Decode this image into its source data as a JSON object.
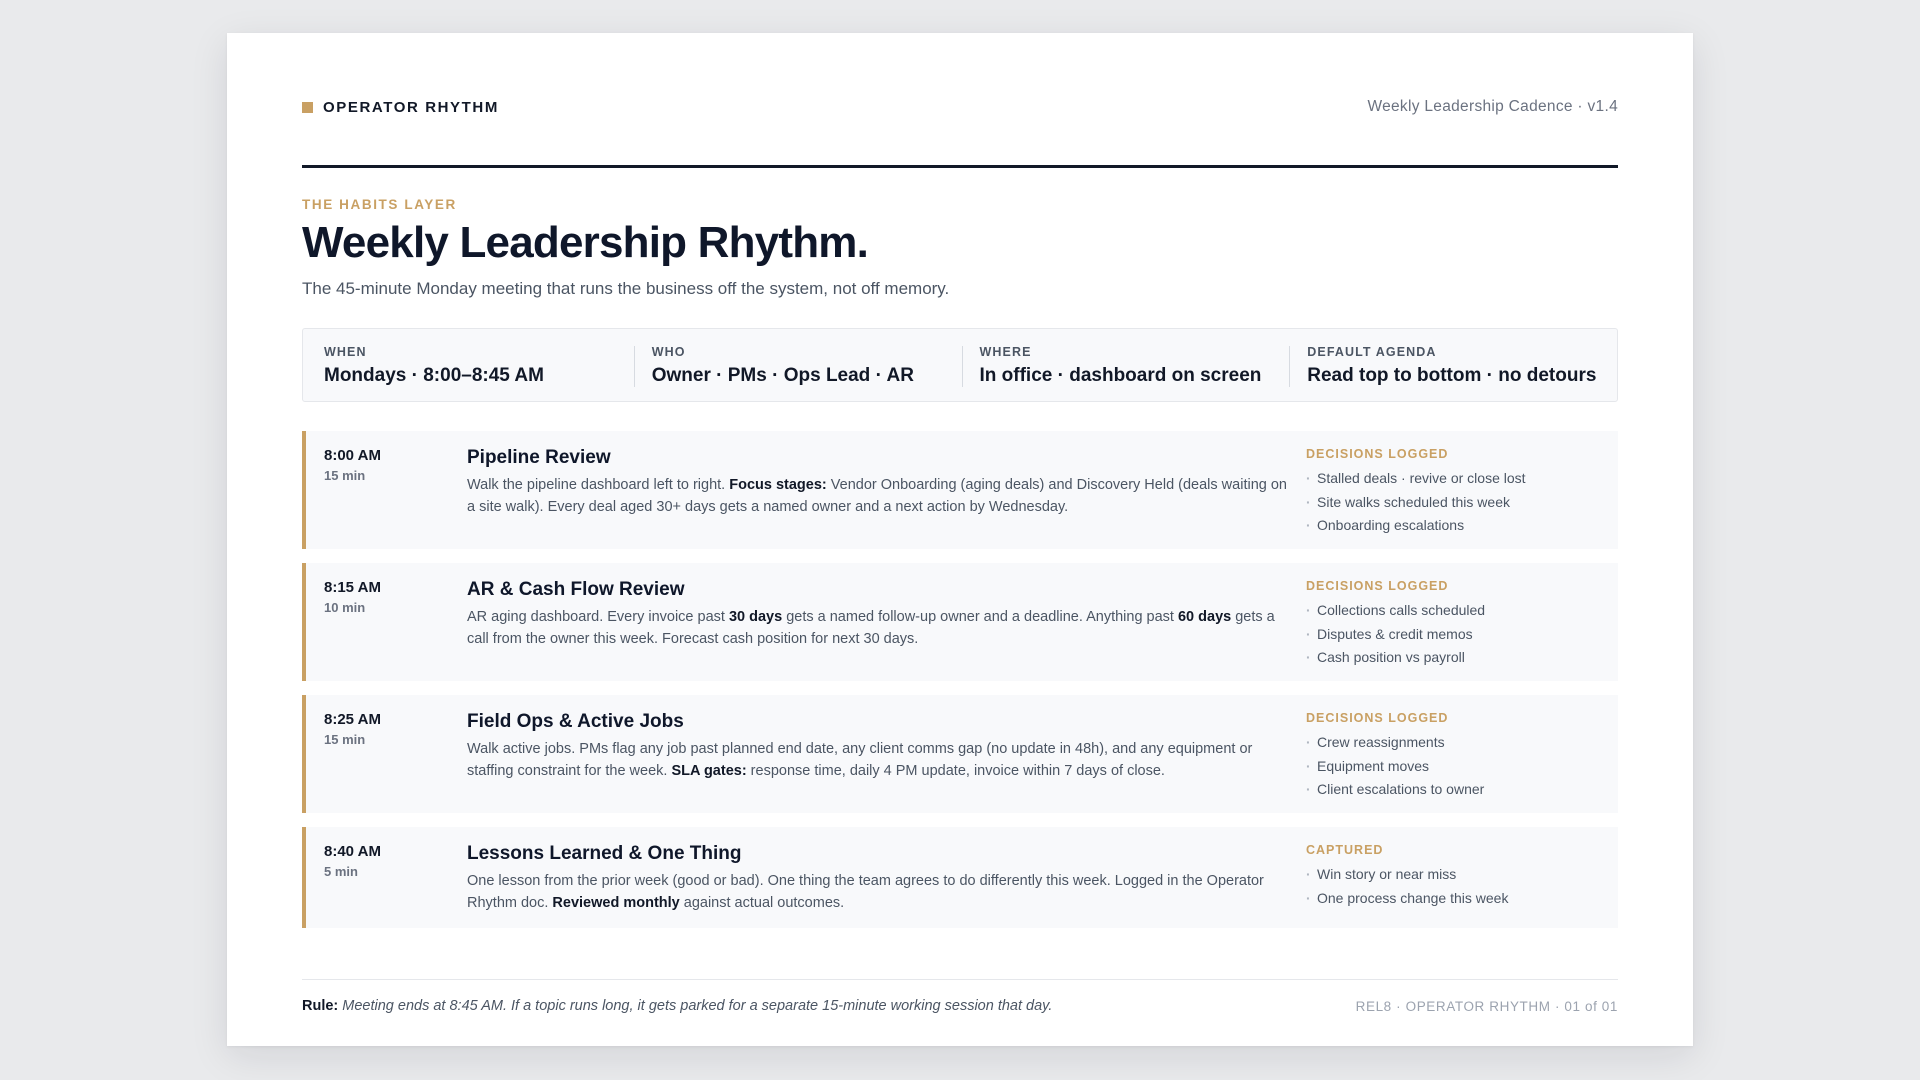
{
  "header": {
    "brand": "OPERATOR RHYTHM",
    "doc_version": "Weekly Leadership Cadence · v1.4"
  },
  "eyebrow": "THE HABITS LAYER",
  "title": "Weekly Leadership Rhythm.",
  "subtitle": "The 45-minute Monday meeting that runs the business off the system, not off memory.",
  "meta": [
    {
      "label": "WHEN",
      "value": "Mondays · 8:00–8:45 AM"
    },
    {
      "label": "WHO",
      "value": "Owner · PMs · Ops Lead · AR"
    },
    {
      "label": "WHERE",
      "value": "In office · dashboard on screen"
    },
    {
      "label": "DEFAULT AGENDA",
      "value": "Read top to bottom · no detours"
    }
  ],
  "agenda": [
    {
      "time": "8:00 AM",
      "duration": "15 min",
      "title": "Pipeline Review",
      "desc": [
        {
          "t": "Walk the pipeline dashboard left to right. "
        },
        {
          "t": "Focus stages:",
          "b": true
        },
        {
          "t": " Vendor Onboarding (aging deals) and Discovery Held (deals waiting on a site walk). Every deal aged 30+ days gets a named owner and a next action by Wednesday."
        }
      ],
      "side_label": "DECISIONS LOGGED",
      "side_items": [
        "Stalled deals · revive or close lost",
        "Site walks scheduled this week",
        "Onboarding escalations"
      ]
    },
    {
      "time": "8:15 AM",
      "duration": "10 min",
      "title": "AR & Cash Flow Review",
      "desc": [
        {
          "t": "AR aging dashboard. Every invoice past "
        },
        {
          "t": "30 days",
          "b": true
        },
        {
          "t": " gets a named follow-up owner and a deadline. Anything past "
        },
        {
          "t": "60 days",
          "b": true
        },
        {
          "t": " gets a call from the owner this week. Forecast cash position for next 30 days."
        }
      ],
      "side_label": "DECISIONS LOGGED",
      "side_items": [
        "Collections calls scheduled",
        "Disputes & credit memos",
        "Cash position vs payroll"
      ]
    },
    {
      "time": "8:25 AM",
      "duration": "15 min",
      "title": "Field Ops & Active Jobs",
      "desc": [
        {
          "t": "Walk active jobs. PMs flag any job past planned end date, any client comms gap (no update in 48h), and any equipment or staffing constraint for the week. "
        },
        {
          "t": "SLA gates:",
          "b": true
        },
        {
          "t": " response time, daily 4 PM update, invoice within 7 days of close."
        }
      ],
      "side_label": "DECISIONS LOGGED",
      "side_items": [
        "Crew reassignments",
        "Equipment moves",
        "Client escalations to owner"
      ]
    },
    {
      "time": "8:40 AM",
      "duration": "5 min",
      "title": "Lessons Learned & One Thing",
      "desc": [
        {
          "t": "One lesson from the prior week (good or bad). One thing the team agrees to do differently this week. Logged in the Operator Rhythm doc. "
        },
        {
          "t": "Reviewed monthly",
          "b": true
        },
        {
          "t": " against actual outcomes."
        }
      ],
      "side_label": "CAPTURED",
      "side_items": [
        "Win story or near miss",
        "One process change this week"
      ]
    }
  ],
  "footer": {
    "rule_label": "Rule:",
    "rule_text": "Meeting ends at 8:45 AM. If a topic runs long, it gets parked for a separate 15-minute working session that day.",
    "page_ref": "REL8 · OPERATOR RHYTHM · 01 of 01"
  },
  "colors": {
    "accent": "#c9a063",
    "ink": "#111827",
    "muted": "#4b5563",
    "panel": "#f8f9fb",
    "background": "#e9eaec"
  }
}
